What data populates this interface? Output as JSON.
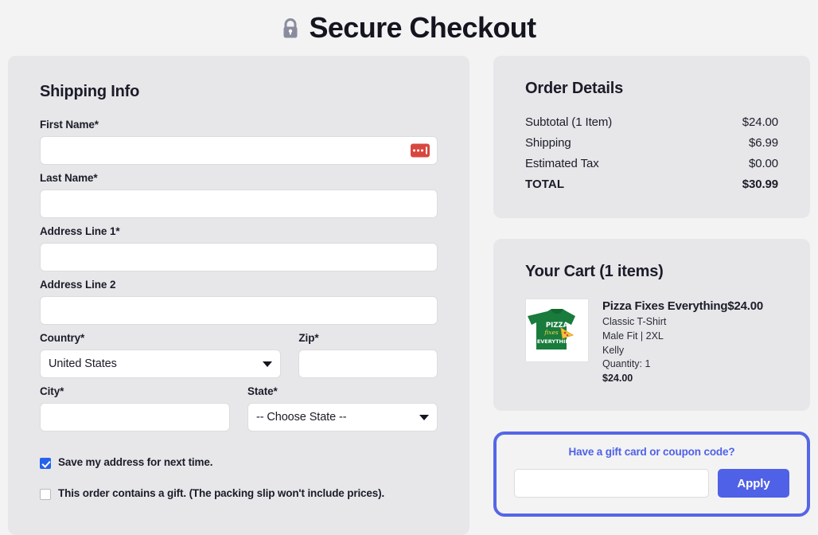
{
  "header": {
    "title": "Secure Checkout",
    "lock_icon": "lock-icon"
  },
  "shipping": {
    "section_title": "Shipping Info",
    "fields": [
      {
        "label": "First Name*",
        "value": "",
        "placeholder": ""
      },
      {
        "label": "Last Name*",
        "value": "",
        "placeholder": ""
      },
      {
        "label": "Address Line 1*",
        "value": "",
        "placeholder": ""
      },
      {
        "label": "Address Line 2",
        "value": "",
        "placeholder": ""
      },
      {
        "label": "Country*",
        "value": "United States",
        "placeholder": ""
      },
      {
        "label": "Zip*",
        "value": "",
        "placeholder": ""
      },
      {
        "label": "City*",
        "value": "",
        "placeholder": ""
      },
      {
        "label": "State*",
        "value": "-- Choose State --",
        "placeholder": ""
      }
    ],
    "autofill_icon": "password-autofill-icon",
    "checkboxes": [
      {
        "label": "Save my address for next time.",
        "checked": true
      },
      {
        "label": "This order contains a gift. (The packing slip won't include prices).",
        "checked": false
      }
    ]
  },
  "order_details": {
    "title": "Order Details",
    "rows": [
      {
        "label": "Subtotal (1 Item)",
        "value": "$24.00"
      },
      {
        "label": "Shipping",
        "value": "$6.99"
      },
      {
        "label": "Estimated Tax",
        "value": "$0.00"
      }
    ],
    "total": {
      "label": "TOTAL",
      "value": "$30.99"
    }
  },
  "cart": {
    "title": "Your Cart (1 items)",
    "item": {
      "title_and_price": "Pizza Fixes Everything$24.00",
      "style": "Classic T-Shirt",
      "fit_size": "Male Fit | 2XL",
      "color": "Kelly",
      "quantity": "Quantity: 1",
      "price": "$24.00",
      "thumb_alt": "green-tshirt-pizza-fixes-everything"
    }
  },
  "coupon": {
    "title": "Have a gift card or coupon code?",
    "input_value": "",
    "input_placeholder": "",
    "apply_label": "Apply"
  },
  "colors": {
    "accent_blue": "#4f61e6",
    "checkbox_blue": "#2563eb",
    "autofill_red": "#d8473f",
    "panel_gray": "#e7e7ea",
    "page_bg": "#f3f3f4",
    "shirt_green": "#197b3c"
  }
}
